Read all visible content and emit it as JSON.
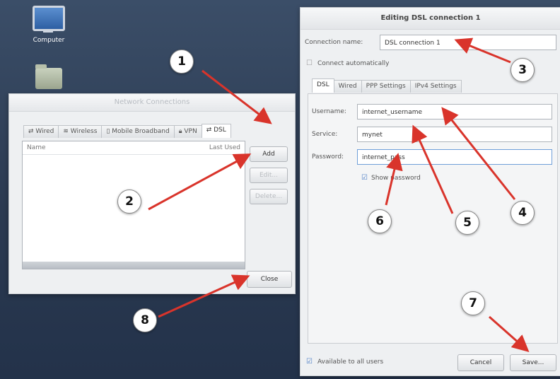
{
  "desktop": {
    "icons": [
      {
        "label": "Computer",
        "icon": "computer-icon"
      },
      {
        "label": "",
        "icon": "home-folder-icon"
      }
    ]
  },
  "net_dialog": {
    "title": "Network Connections",
    "tabs": [
      {
        "label": "Wired",
        "icon": "wired-icon"
      },
      {
        "label": "Wireless",
        "icon": "wireless-icon"
      },
      {
        "label": "Mobile Broadband",
        "icon": "mobile-broadband-icon"
      },
      {
        "label": "VPN",
        "icon": "vpn-icon"
      },
      {
        "label": "DSL",
        "icon": "dsl-icon",
        "active": true
      }
    ],
    "columns": {
      "name": "Name",
      "last_used": "Last Used"
    },
    "buttons": {
      "add": "Add",
      "edit": "Edit...",
      "delete": "Delete...",
      "close": "Close"
    }
  },
  "dsl_dialog": {
    "title": "Editing DSL connection 1",
    "connection_name_label": "Connection name:",
    "connection_name_value": "DSL connection 1",
    "connect_automatically": "Connect automatically",
    "tabs": [
      "DSL",
      "Wired",
      "PPP Settings",
      "IPv4 Settings"
    ],
    "username_label": "Username:",
    "username_value": "internet_username",
    "service_label": "Service:",
    "service_value": "mynet",
    "password_label": "Password:",
    "password_value": "internet_pass",
    "show_password": "Show password",
    "available_all_users": "Available to all users",
    "cancel": "Cancel",
    "save": "Save..."
  },
  "callouts": [
    "1",
    "2",
    "3",
    "4",
    "5",
    "6",
    "7",
    "8"
  ],
  "colors": {
    "arrow": "#d9342b",
    "desktop": "#33465f"
  }
}
